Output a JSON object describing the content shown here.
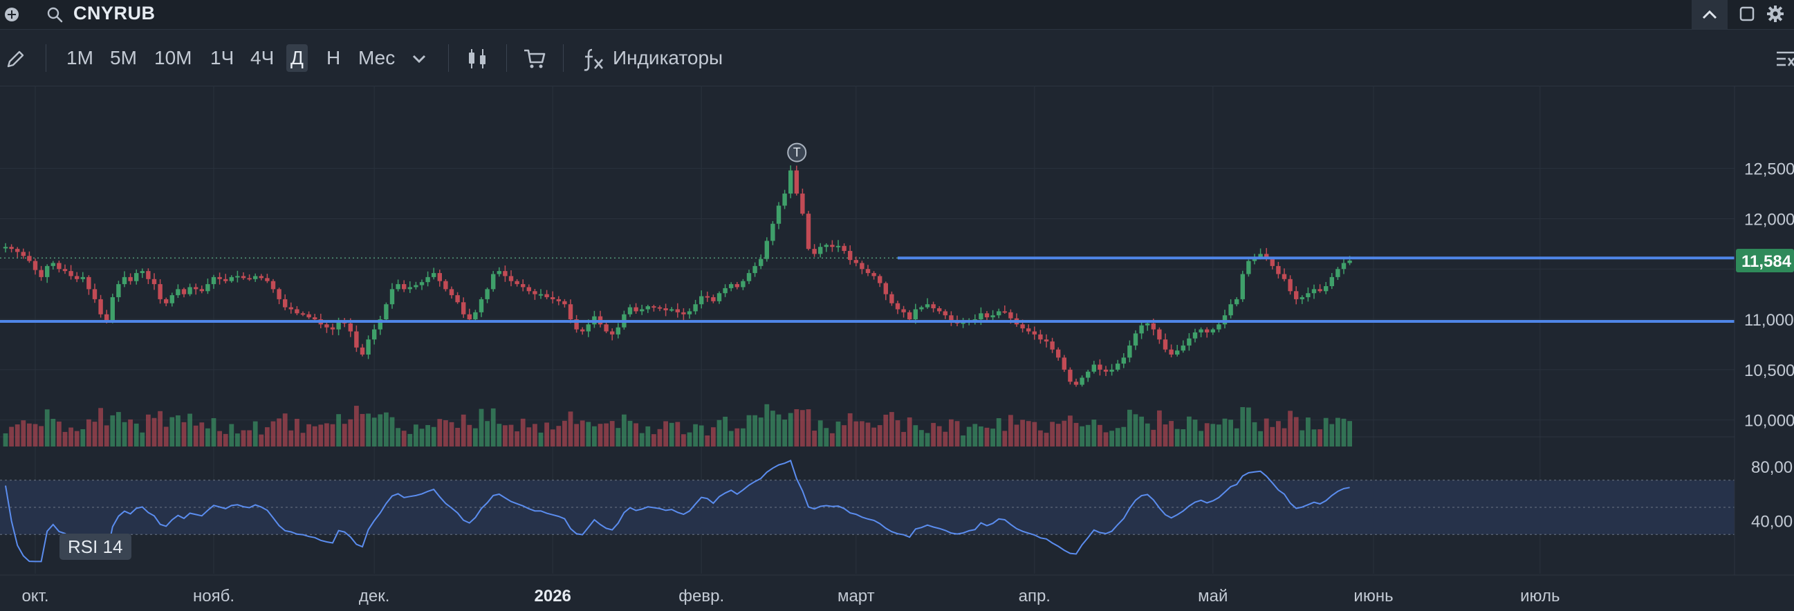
{
  "ticker": "CNYRUB",
  "toolbar": {
    "timeframes": [
      "1М",
      "5М",
      "10М",
      "1Ч",
      "4Ч",
      "Д",
      "Н",
      "Мес"
    ],
    "active_timeframe": "Д",
    "indicators_label": "Индикаторы"
  },
  "icons": {
    "add": "plus-circle-icon",
    "search": "search-icon",
    "collapse": "chevron-up-icon",
    "window": "window-icon",
    "settings": "gear-icon",
    "pencil": "pencil-icon",
    "dropdown": "chevron-down-icon",
    "candles": "candlestick-icon",
    "cart": "cart-icon",
    "fx": "fx-icon",
    "panel": "panel-toggle-icon"
  },
  "colors": {
    "up": "#3fa06a",
    "down": "#c24b55",
    "level_line": "#4f86e8",
    "price_badge": "#2f8a5a",
    "rsi_line": "#5b8def",
    "rsi_band": "#26324a"
  },
  "chart_data": {
    "type": "candlestick",
    "price_axis": {
      "ticks": [
        12500,
        12000,
        11500,
        11000,
        10500,
        10000
      ],
      "tick_labels": [
        "12,500",
        "12,000",
        "",
        "11,000",
        "10,500",
        "10,000"
      ],
      "range": [
        9750,
        12800
      ]
    },
    "x_axis": {
      "labels": [
        "окт.",
        "нояб.",
        "дек.",
        "2026",
        "февр.",
        "март",
        "апр.",
        "май",
        "июнь",
        "июль"
      ],
      "label_candle_index": [
        5,
        35,
        62,
        92,
        117,
        143,
        173,
        203,
        230,
        258
      ]
    },
    "current_price": 11.584,
    "current_price_label": "11,584",
    "marker_label": "T",
    "horizontal_levels": [
      11610,
      10980
    ],
    "dotted_level": 11610,
    "closes": [
      11720,
      11700,
      11670,
      11630,
      11580,
      11490,
      11420,
      11530,
      11560,
      11500,
      11480,
      11430,
      11400,
      11420,
      11300,
      11200,
      11050,
      10980,
      11220,
      11350,
      11420,
      11380,
      11460,
      11480,
      11400,
      11350,
      11200,
      11160,
      11240,
      11300,
      11250,
      11320,
      11300,
      11280,
      11350,
      11420,
      11400,
      11380,
      11420,
      11430,
      11410,
      11400,
      11430,
      11410,
      11380,
      11300,
      11200,
      11120,
      11100,
      11060,
      11050,
      11020,
      11000,
      10950,
      10920,
      10900,
      10980,
      10960,
      10880,
      10720,
      10650,
      10800,
      10900,
      11000,
      11150,
      11300,
      11350,
      11300,
      11320,
      11340,
      11370,
      11420,
      11460,
      11380,
      11300,
      11240,
      11170,
      11050,
      11000,
      11070,
      11200,
      11300,
      11450,
      11480,
      11430,
      11380,
      11350,
      11320,
      11280,
      11250,
      11250,
      11220,
      11200,
      11180,
      11150,
      11000,
      10900,
      10880,
      10950,
      11030,
      10950,
      10880,
      10850,
      10920,
      11050,
      11120,
      11080,
      11100,
      11130,
      11120,
      11110,
      11090,
      11100,
      11070,
      11050,
      11080,
      11150,
      11230,
      11220,
      11180,
      11260,
      11310,
      11350,
      11320,
      11380,
      11460,
      11530,
      11600,
      11780,
      11950,
      12130,
      12250,
      12480,
      12250,
      12050,
      11700,
      11650,
      11720,
      11740,
      11720,
      11730,
      11680,
      11590,
      11560,
      11500,
      11460,
      11430,
      11360,
      11250,
      11160,
      11100,
      11070,
      11000,
      11100,
      11120,
      11150,
      11110,
      11080,
      11040,
      10980,
      10960,
      10970,
      10990,
      11000,
      11060,
      11020,
      11040,
      11080,
      11070,
      11010,
      10950,
      10910,
      10880,
      10850,
      10800,
      10780,
      10700,
      10620,
      10500,
      10380,
      10350,
      10420,
      10480,
      10550,
      10500,
      10480,
      10500,
      10560,
      10620,
      10740,
      10860,
      10940,
      10960,
      10900,
      10800,
      10700,
      10650,
      10690,
      10740,
      10810,
      10870,
      10900,
      10870,
      10900,
      10950,
      11040,
      11150,
      11200,
      11450,
      11580,
      11620,
      11650,
      11600,
      11530,
      11450,
      11400,
      11280,
      11200,
      11220,
      11260,
      11300,
      11280,
      11330,
      11420,
      11500,
      11560,
      11584
    ],
    "rsi": {
      "name": "RSI 14",
      "ticks": [
        80,
        40
      ],
      "tick_labels": [
        "80,00",
        "40,00"
      ],
      "band": [
        30,
        70
      ],
      "mid": 50,
      "range": [
        0,
        100
      ]
    }
  }
}
